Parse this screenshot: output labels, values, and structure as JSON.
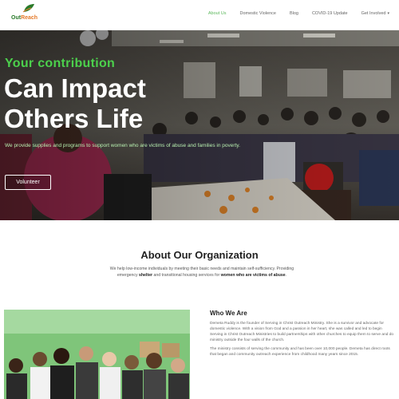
{
  "header": {
    "logo_text_a": "Out",
    "logo_text_b": "Reach",
    "nav": [
      {
        "label": "About Us",
        "active": true
      },
      {
        "label": "Domestic Violence",
        "active": false
      },
      {
        "label": "Blog",
        "active": false
      },
      {
        "label": "COVID-19 Update",
        "active": false
      },
      {
        "label": "Get Involved",
        "active": false
      }
    ]
  },
  "hero": {
    "kicker": "Your contribution",
    "title_line1": "Can Impact",
    "title_line2": "Others Life",
    "description": "We provide supplies and programs to support women who are victims of abuse and families in poverty.",
    "button_label": "Volunteer"
  },
  "about": {
    "title": "About Our Organization",
    "text_part1": "We help low-income individuals by meeting their basic needs and maintain self-sufficiency. Providing emergency ",
    "text_bold1": "shelter",
    "text_part2": " and transitional housing services for ",
    "text_bold2": "women who are victims of abuse",
    "text_part3": "."
  },
  "who": {
    "title": "Who We Are",
    "paragraph1": "Demeta Ruddy is the founder of Serving in Christ Outreach Ministry. She is a survivor and advocate for domestic violence. With a vision from God and a passion in her heart, she was called and led to begin Serving in Christ Outreach Ministries to build partnerships with other churches to equip them to serve and do ministry outside the four walls of the church.",
    "paragraph2": "The ministry consists of serving the community and has been over 10,000 people. Demeta has direct roots that began and community outreach experience from childhood many years since 2015."
  },
  "colors": {
    "accent_green": "#4cd04c",
    "nav_active": "#5cb85c",
    "logo_green": "#2a7a2a",
    "logo_orange": "#e57a2a"
  }
}
